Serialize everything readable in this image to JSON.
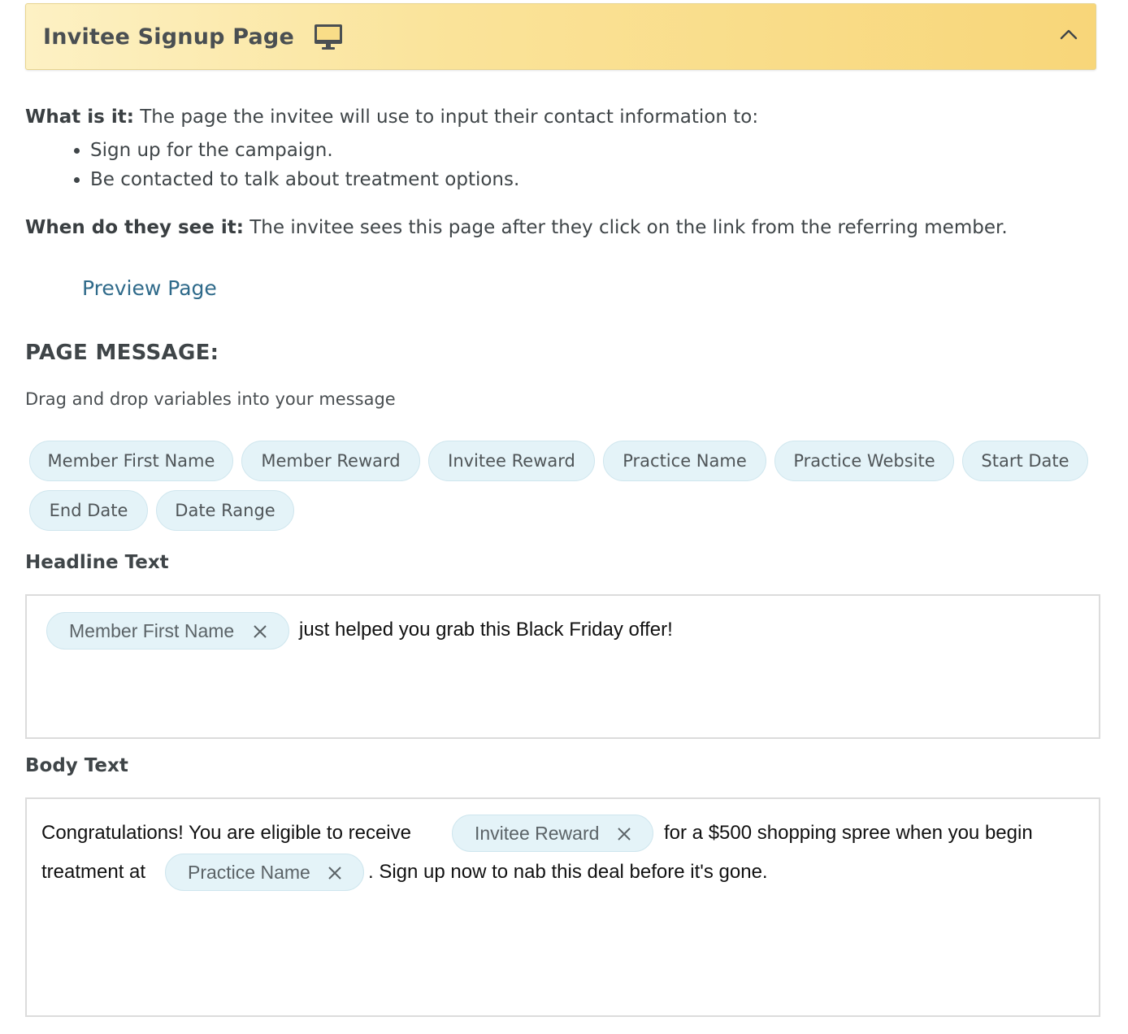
{
  "panel": {
    "title": "Invitee Signup Page",
    "icon": "monitor-icon",
    "toggle_icon": "chevron-up-icon"
  },
  "description": {
    "what_label": "What is it:",
    "what_text": " The page the invitee will use to input their contact information to:",
    "bullets": [
      "Sign up for the campaign.",
      "Be contacted to talk about treatment options."
    ],
    "when_label": "When do they see it:",
    "when_text": " The invitee sees this page after they click on the link from the referring member."
  },
  "preview_link": "Preview Page",
  "page_message": {
    "heading": "PAGE MESSAGE:",
    "hint": "Drag and drop variables into your message",
    "variables": [
      "Member First Name",
      "Member Reward",
      "Invitee Reward",
      "Practice Name",
      "Practice Website",
      "Start Date",
      "End Date",
      "Date Range"
    ]
  },
  "headline": {
    "label": "Headline Text",
    "token_1": "Member First Name",
    "text_1": "just helped you grab this Black Friday offer!"
  },
  "body": {
    "label": "Body Text",
    "text_1": "Congratulations! You are eligible to receive",
    "token_1": "Invitee Reward",
    "text_2": "for a $500 shopping spree when you begin",
    "text_3": "treatment at",
    "token_2": "Practice Name",
    "text_4": ". Sign up now to nab this deal before it's gone."
  },
  "colors": {
    "header_gradient_start": "#fdf1c4",
    "header_gradient_end": "#f8d679",
    "chip_background": "#e4f3f8",
    "link": "#2f6a8a"
  }
}
